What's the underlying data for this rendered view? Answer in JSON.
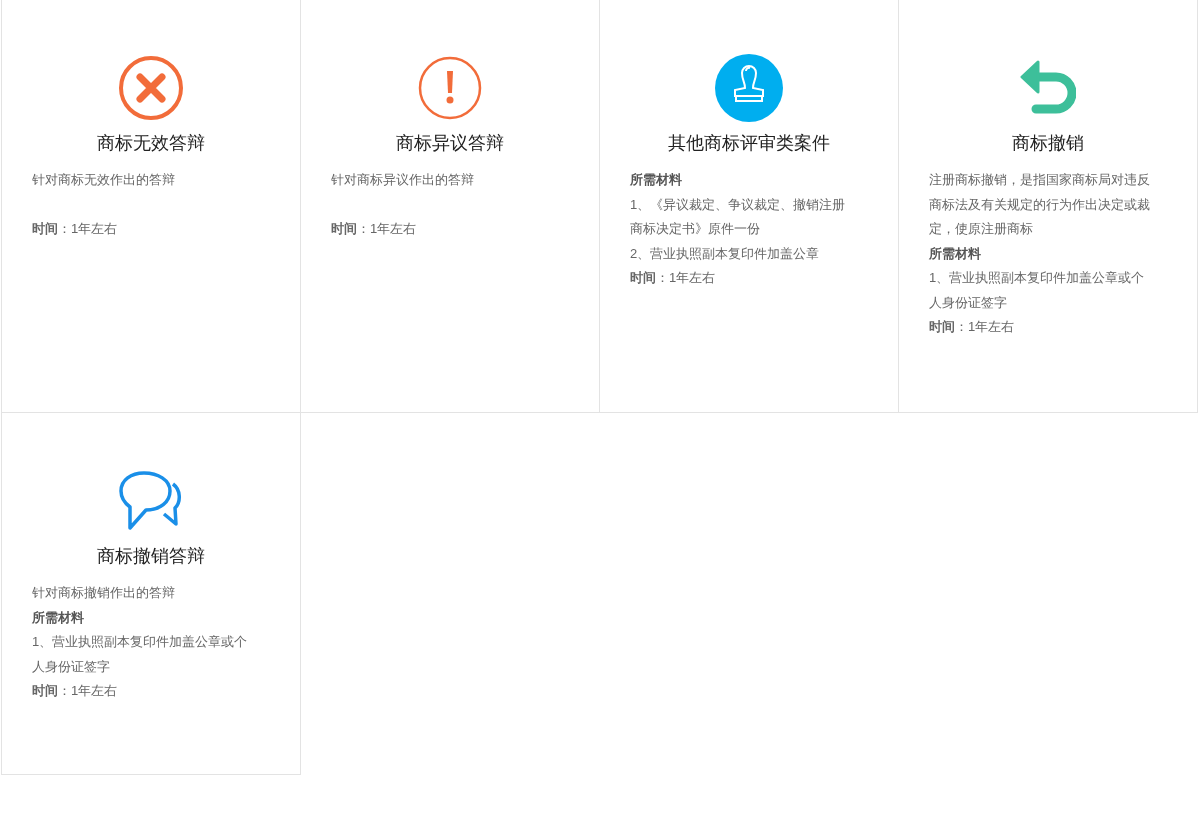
{
  "cards": [
    {
      "kind": "cross",
      "title": "商标无效答辩",
      "lines": [
        {
          "kind": "text",
          "text": "针对商标无效作出的答辩"
        },
        {
          "kind": "break"
        },
        {
          "kind": "text",
          "text": "**时间**：1年左右"
        }
      ]
    },
    {
      "kind": "exclaim",
      "title": "商标异议答辩",
      "lines": [
        {
          "kind": "text",
          "text": "针对商标异议作出的答辩"
        },
        {
          "kind": "break"
        },
        {
          "kind": "text",
          "text": "**时间**：1年左右"
        }
      ]
    },
    {
      "kind": "stamp",
      "title": "其他商标评审类案件",
      "lines": [
        {
          "kind": "heading",
          "text": "所需材料"
        },
        {
          "kind": "text",
          "text": "1、《异议裁定、争议裁定、撤销注册商标决定书》原件一份"
        },
        {
          "kind": "text",
          "text": "2、营业执照副本复印件加盖公章"
        },
        {
          "kind": "text",
          "text": "**时间**：1年左右"
        }
      ]
    },
    {
      "kind": "undo",
      "title": "商标撤销",
      "lines": [
        {
          "kind": "text",
          "text": "注册商标撤销，是指国家商标局对违反商标法及有关规定的行为作出决定或裁定，使原注册商标"
        },
        {
          "kind": "heading",
          "text": "所需材料"
        },
        {
          "kind": "text",
          "text": "1、营业执照副本复印件加盖公章或个人身份证签字"
        },
        {
          "kind": "text",
          "text": "**时间**：1年左右"
        }
      ]
    },
    {
      "kind": "chat",
      "title": "商标撤销答辩",
      "lines": [
        {
          "kind": "text",
          "text": "针对商标撤销作出的答辩"
        },
        {
          "kind": "heading",
          "text": "所需材料"
        },
        {
          "kind": "text",
          "text": "1、营业执照副本复印件加盖公章或个人身份证签字"
        },
        {
          "kind": "text",
          "text": "**时间**：1年左右"
        }
      ]
    }
  ]
}
